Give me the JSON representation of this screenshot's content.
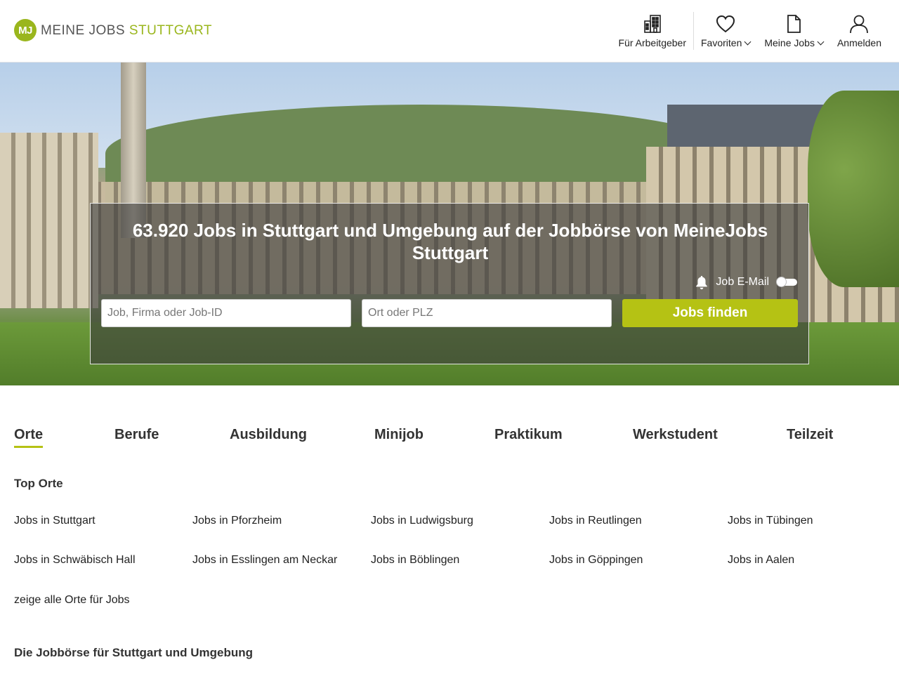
{
  "logo": {
    "badge": "MJ",
    "text_a": "MEINE JOBS",
    "text_b": "STUTTGART"
  },
  "nav": {
    "employer": "Für Arbeitgeber",
    "favorites": "Favoriten",
    "my_jobs": "Meine Jobs",
    "login": "Anmelden"
  },
  "hero": {
    "title": "63.920 Jobs in Stuttgart und Umgebung auf der Jobbörse von MeineJobs Stuttgart",
    "job_email_label": "Job E-Mail",
    "job_placeholder": "Job, Firma oder Job-ID",
    "location_placeholder": "Ort oder PLZ",
    "search_button": "Jobs finden"
  },
  "tabs": [
    "Orte",
    "Berufe",
    "Ausbildung",
    "Minijob",
    "Praktikum",
    "Werkstudent",
    "Teilzeit"
  ],
  "top_places": {
    "title": "Top Orte",
    "links": [
      "Jobs in Stuttgart",
      "Jobs in Pforzheim",
      "Jobs in Ludwigsburg",
      "Jobs in Reutlingen",
      "Jobs in Tübingen",
      "Jobs in Schwäbisch Hall",
      "Jobs in Esslingen am Neckar",
      "Jobs in Böblingen",
      "Jobs in Göppingen",
      "Jobs in Aalen"
    ],
    "show_all": "zeige alle Orte für Jobs"
  },
  "footer_section": {
    "title": "Die Jobbörse für Stuttgart und Umgebung"
  },
  "colors": {
    "brand_green": "#9ab61d",
    "button_green": "#b5c214"
  }
}
